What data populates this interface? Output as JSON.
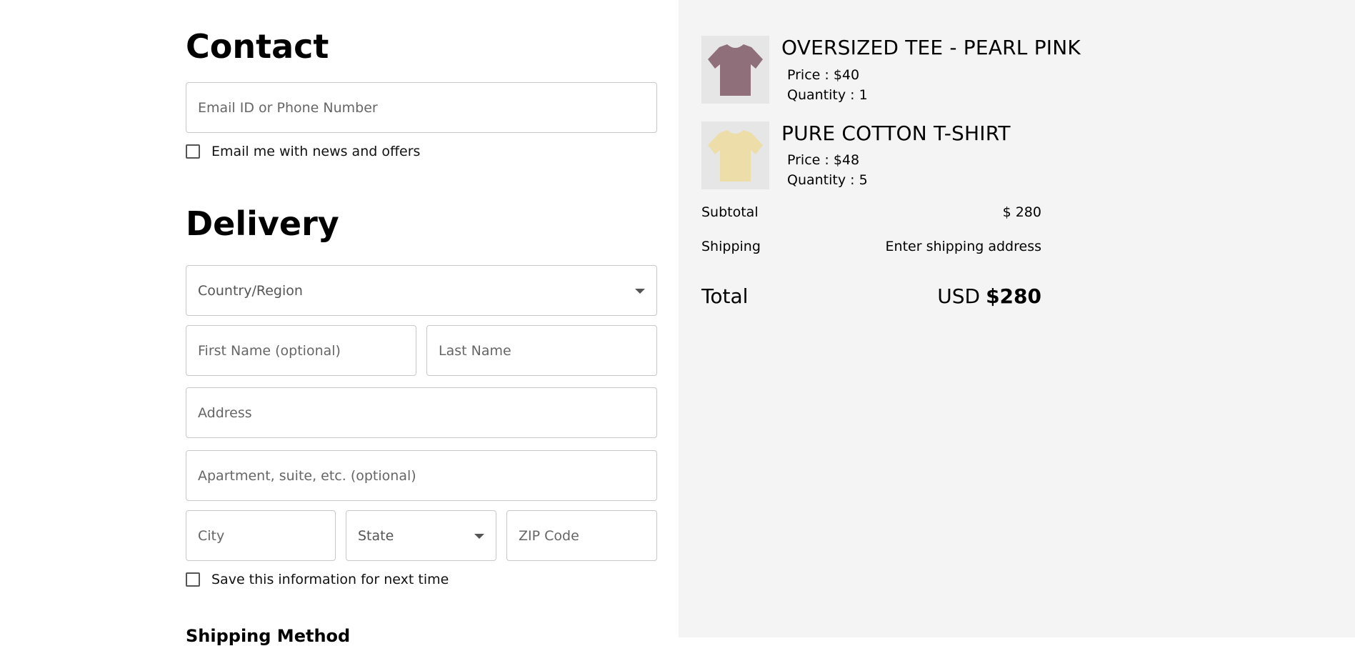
{
  "contact": {
    "heading": "Contact",
    "email_placeholder": "Email ID or Phone Number",
    "news_label": "Email me with news and offers"
  },
  "delivery": {
    "heading": "Delivery",
    "country_label": "Country/Region",
    "first_name_placeholder": "First Name (optional)",
    "last_name_placeholder": "Last Name",
    "address_placeholder": "Address",
    "apartment_placeholder": "Apartment, suite, etc. (optional)",
    "city_placeholder": "City",
    "state_label": "State",
    "zip_placeholder": "ZIP Code",
    "save_label": "Save this information for next time"
  },
  "shipping_method": {
    "heading": "Shipping Method"
  },
  "cart": {
    "items": [
      {
        "name": "OVERSIZED TEE - PEARL PINK",
        "price": "Price : $40",
        "quantity": "Quantity : 1",
        "color": "#8e6f7a",
        "icon": "tshirt-icon"
      },
      {
        "name": "PURE COTTON T-SHIRT",
        "price": "Price : $48",
        "quantity": "Quantity : 5",
        "color": "#ecdda9",
        "icon": "tshirt-icon"
      }
    ]
  },
  "summary": {
    "subtotal_label": "Subtotal",
    "subtotal_value": "$ 280",
    "shipping_label": "Shipping",
    "shipping_value": "Enter shipping address",
    "total_label": "Total",
    "total_currency": "USD",
    "total_value": "$280"
  }
}
